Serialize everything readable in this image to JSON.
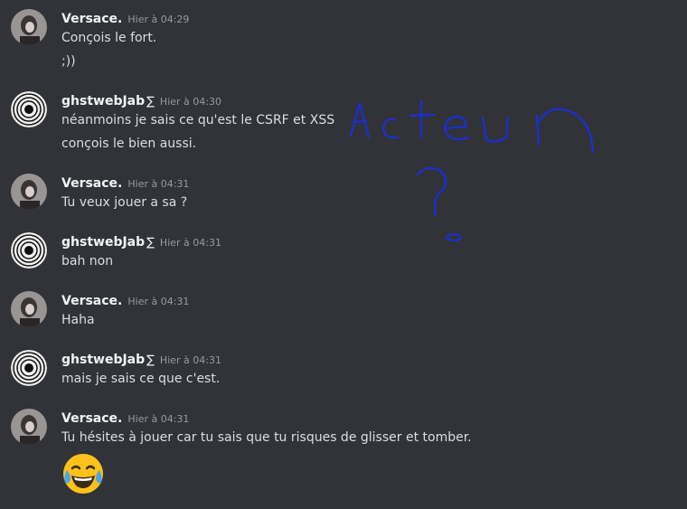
{
  "messages": [
    {
      "username": "Versace.",
      "timestamp": "Hier à 04:29",
      "lines": [
        "Conçois le fort.",
        ";))"
      ]
    },
    {
      "username": "ghstwebJab",
      "tag": "∑",
      "timestamp": "Hier à 04:30",
      "lines": [
        "néanmoins je sais ce qu'est le CSRF et XSS",
        "conçois le bien aussi."
      ]
    },
    {
      "username": "Versace.",
      "timestamp": "Hier à 04:31",
      "lines": [
        "Tu veux jouer a sa ?"
      ]
    },
    {
      "username": "ghstwebJab",
      "tag": "∑",
      "timestamp": "Hier à 04:31",
      "lines": [
        "bah non"
      ]
    },
    {
      "username": "Versace.",
      "timestamp": "Hier à 04:31",
      "lines": [
        "Haha"
      ]
    },
    {
      "username": "ghstwebJab",
      "tag": "∑",
      "timestamp": "Hier à 04:31",
      "lines": [
        "mais je sais ce que c'est."
      ]
    },
    {
      "username": "Versace.",
      "timestamp": "Hier à 04:31",
      "lines": [
        "Tu hésites à jouer car tu sais que tu risques de glisser et tomber."
      ],
      "emoji": "joy-emoji"
    }
  ],
  "overlay_drawing": {
    "text": "Acteur ?",
    "color": "#1a2fd6"
  },
  "colors": {
    "background": "#313338",
    "username": "#f2f3f5",
    "timestamp": "#949ba4",
    "text": "#dbdee1"
  }
}
